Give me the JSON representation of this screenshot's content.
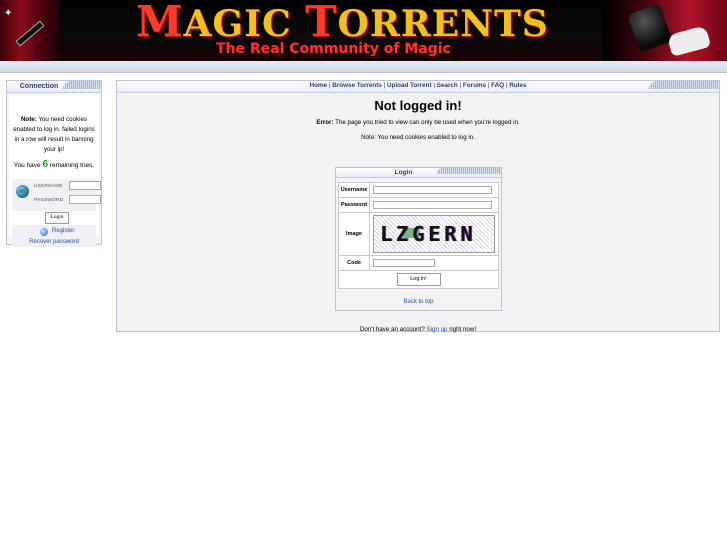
{
  "banner": {
    "title_first_cap": "M",
    "title_rest_1": "AGIC ",
    "title_second_cap": "T",
    "title_rest_2": "ORRENTS",
    "subtitle": "The Real Community of Magic"
  },
  "sidebar": {
    "heading": "Connection",
    "note_bold": "Note:",
    "note_text": " You need cookies enabled to log in. failed logins in a row will result in banning your ip!",
    "tries_prefix": "You have ",
    "tries_count": "6",
    "tries_suffix": " remaining tries.",
    "username_label": "USERNAME",
    "password_label": "PASSWORD",
    "login_button": "Login",
    "register_link": "Register",
    "recover_link": "Recover password"
  },
  "nav": {
    "items": [
      "Home",
      "Browse Torrents",
      "Upload Torrent",
      "Search",
      "Forums",
      "FAQ",
      "Rules"
    ],
    "separator": " | "
  },
  "main": {
    "heading": "Not logged in!",
    "error_label": "Error:",
    "error_text": " The page you tried to view can only be used when you're logged in.",
    "note_text": "Note: You need cookies enabled to log in."
  },
  "login_form": {
    "heading": "Login",
    "username_label": "Username",
    "password_label": "Password",
    "image_label": "Image",
    "captcha_text": "LZGERN",
    "code_label": "Code",
    "submit_button": "Log in!",
    "back_to_top": "Back to top"
  },
  "signup": {
    "prefix": "Don't have an account? ",
    "link": "Sign up",
    "suffix": " right now!"
  },
  "colors": {
    "link": "#2c4c9c",
    "tries_count": "#1aa31a",
    "header_text": "#2a3d6e",
    "banner_gold": "#f0c020",
    "banner_red": "#ff3030"
  }
}
